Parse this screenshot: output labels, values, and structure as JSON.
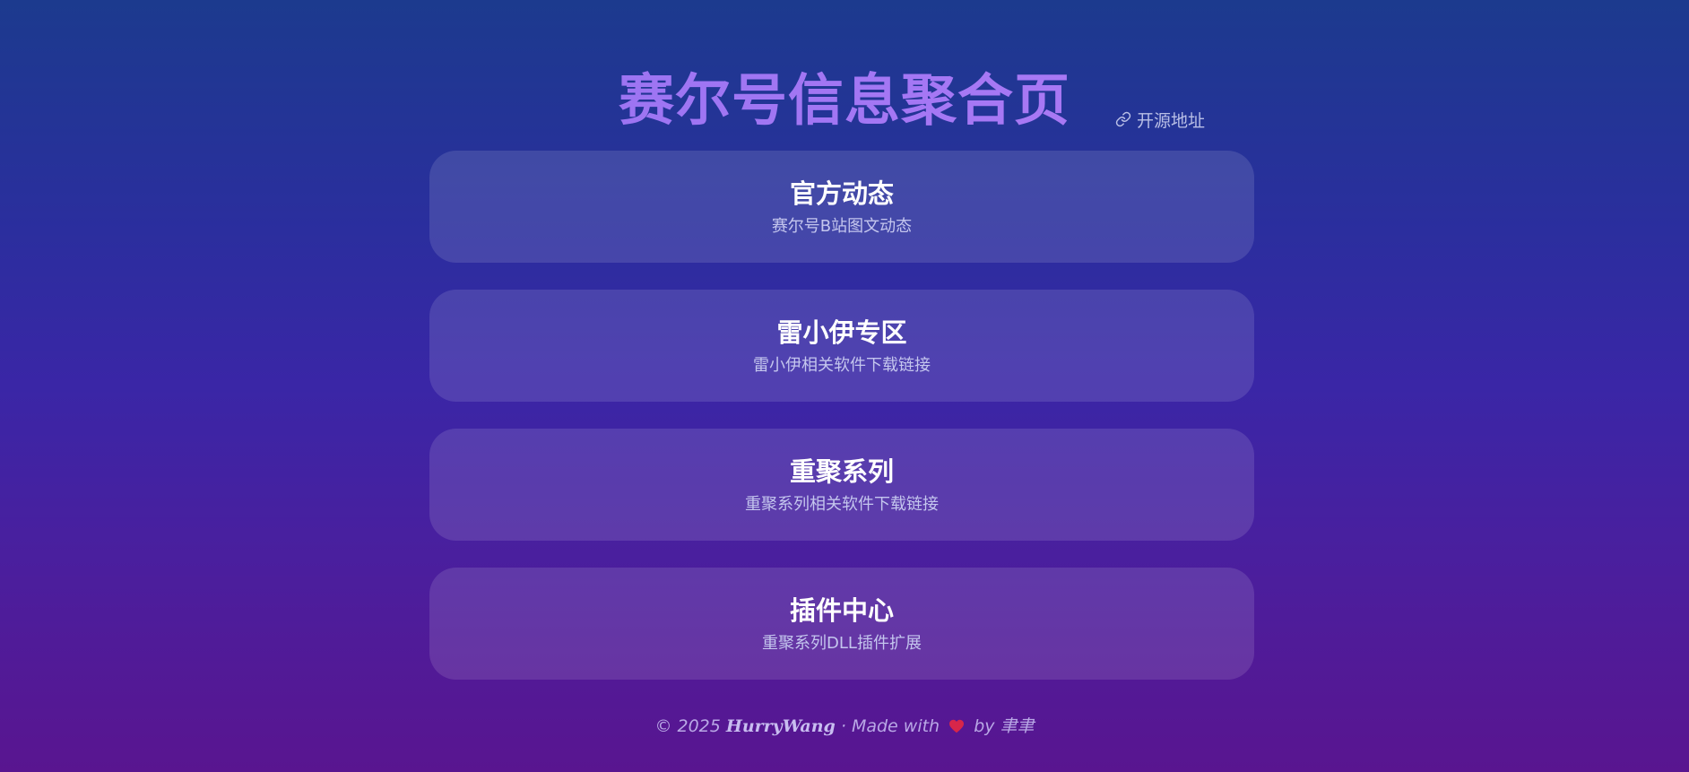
{
  "header": {
    "title": "赛尔号信息聚合页",
    "repo_link_label": "开源地址",
    "repo_link_icon": "link-icon"
  },
  "cards": [
    {
      "title": "官方动态",
      "description": "赛尔号B站图文动态"
    },
    {
      "title": "雷小伊专区",
      "description": "雷小伊相关软件下载链接"
    },
    {
      "title": "重聚系列",
      "description": "重聚系列相关软件下载链接"
    },
    {
      "title": "插件中心",
      "description": "重聚系列DLL插件扩展"
    }
  ],
  "footer": {
    "copyright": "© 2025",
    "brand": "HurryWang",
    "made_with": "· Made with",
    "heart_icon": "heart-icon",
    "by_text": "by 聿聿"
  },
  "colors": {
    "title_accent": "#a173f5",
    "heart": "#d7264a",
    "background_top": "#1c3a8e",
    "background_bottom": "#591590"
  }
}
